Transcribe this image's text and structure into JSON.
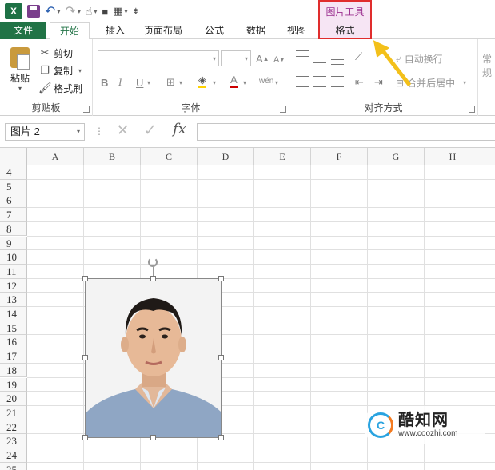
{
  "qat": {
    "logo": "X",
    "icons": [
      "excel-logo",
      "save-icon",
      "undo-icon",
      "redo-icon",
      "touch-mode-icon",
      "camera-icon",
      "layout-icon",
      "customize-icon"
    ]
  },
  "context_tab": {
    "title": "图片工具",
    "tab": "格式"
  },
  "tabs": [
    {
      "label": "文件"
    },
    {
      "label": "开始"
    },
    {
      "label": "插入"
    },
    {
      "label": "页面布局"
    },
    {
      "label": "公式"
    },
    {
      "label": "数据"
    },
    {
      "label": "视图"
    }
  ],
  "ribbon": {
    "clipboard": {
      "paste": "粘贴",
      "cut": "剪切",
      "copy": "复制",
      "format_painter": "格式刷",
      "label": "剪贴板"
    },
    "font": {
      "label": "字体",
      "bold": "B",
      "italic": "I",
      "underline": "U",
      "grow": "A",
      "shrink": "A",
      "font_color": "A",
      "phonetic": "wén"
    },
    "alignment": {
      "label": "对齐方式",
      "wrap_text": "自动换行",
      "merge_center": "合并后居中"
    },
    "number": {
      "label": "常规"
    }
  },
  "formula_bar": {
    "name_box": "图片 2",
    "fx": "fx"
  },
  "grid": {
    "columns": [
      "A",
      "B",
      "C",
      "D",
      "E",
      "F",
      "G",
      "H"
    ],
    "rows": [
      "4",
      "5",
      "6",
      "7",
      "8",
      "9",
      "10",
      "11",
      "12",
      "13",
      "14",
      "15",
      "16",
      "17",
      "18",
      "19",
      "20",
      "21",
      "22",
      "23",
      "24",
      "25"
    ]
  },
  "watermark": {
    "name": "酷知网",
    "url": "www.coozhi.com"
  },
  "colors": {
    "excel_green": "#217346",
    "context_pink": "#f6e5f4",
    "highlight_red": "#e02d2d",
    "arrow_yellow": "#f3c01a"
  }
}
